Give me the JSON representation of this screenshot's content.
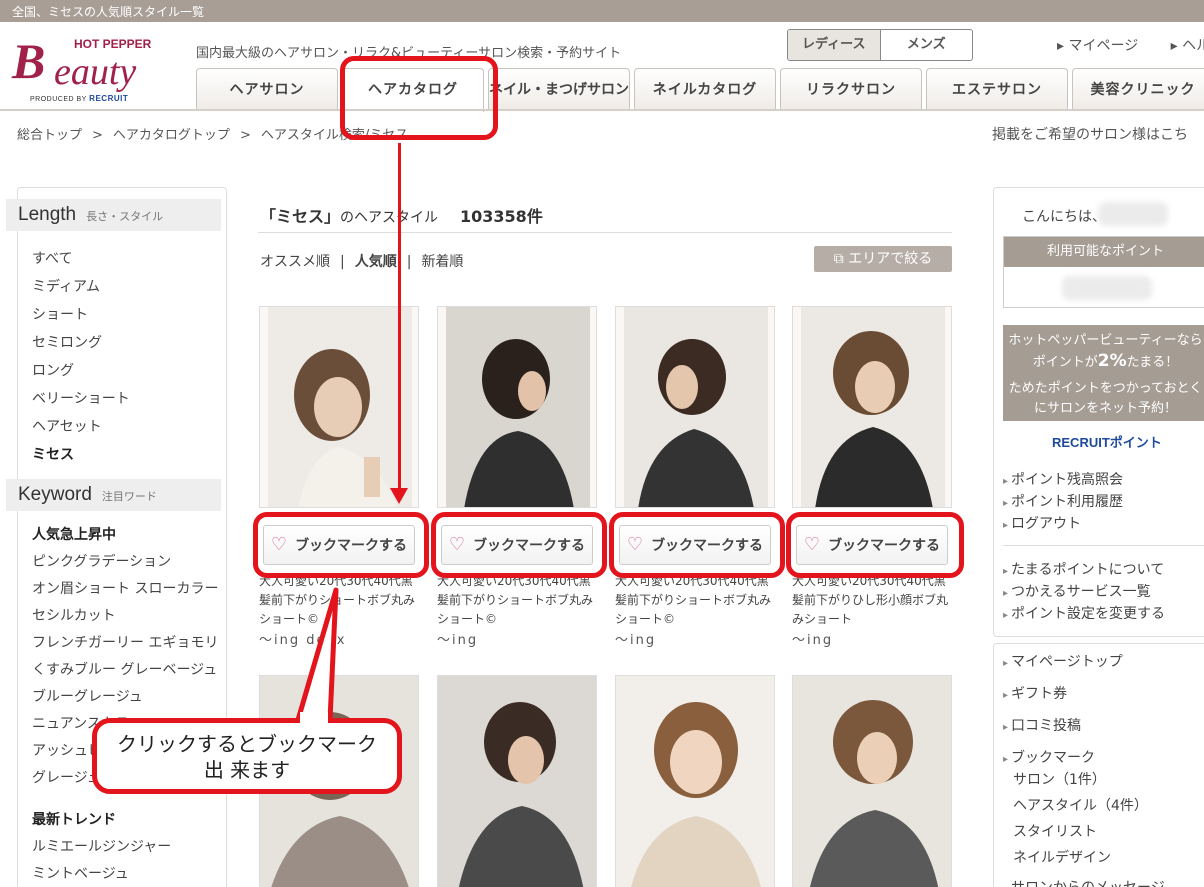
{
  "topbar": {
    "text": "全国、ミセスの人気順スタイル一覧"
  },
  "logo": {
    "brand_small": "HOT PEPPER",
    "brand_b": "B",
    "brand_rest": "eauty",
    "produced": "PRODUCED BY",
    "recruit": "RECRUIT"
  },
  "header": {
    "tagline": "国内最大級のヘアサロン・リラク&ビューティーサロン検索・予約サイト",
    "gender": {
      "ladies": "レディース",
      "mens": "メンズ"
    },
    "links": [
      "マイページ",
      "ヘル"
    ]
  },
  "nav": {
    "tabs": [
      "ヘアサロン",
      "ヘアカタログ",
      "ネイル・まつげサロン",
      "ネイルカタログ",
      "リラクサロン",
      "エステサロン",
      "美容クリニック"
    ]
  },
  "breadcrumb": {
    "items": [
      "総合トップ",
      "ヘアカタログトップ",
      "ヘアスタイル検索/ミセス"
    ],
    "sep": ">"
  },
  "advert_link": "掲載をご希望のサロン様はこち",
  "sidebar": {
    "length_heading": "Length",
    "length_sub": "長さ・スタイル",
    "length_items": [
      "すべて",
      "ミディアム",
      "ショート",
      "セミロング",
      "ロング",
      "ベリーショート",
      "ヘアセット",
      "ミセス"
    ],
    "keyword_heading": "Keyword",
    "keyword_sub": "注目ワード",
    "rising_heading": "人気急上昇中",
    "rising_items": [
      "ピンクグラデーション",
      "オン眉ショート スローカラー",
      "セシルカット",
      "フレンチガーリー エギョモリ",
      "くすみブルー グレーベージュ",
      "ブルーグレージュ",
      "ニュアンスカラ",
      "アッシュピ",
      "グレージュ"
    ],
    "trend_heading": "最新トレンド",
    "trend_items": [
      "ルミエールジンジャー",
      "ミントベージュ"
    ]
  },
  "main": {
    "title_quote": "「ミセス」",
    "title_rest": "のヘアスタイル",
    "count": "103358件",
    "sort": {
      "recommended": "オススメ順",
      "popular": "人気順",
      "newest": "新着順",
      "sep": "|"
    },
    "area_button": "エリアで絞る",
    "bookmark_label": "ブックマークする",
    "cards": [
      {
        "desc": "大人可愛い20代30代40代黒髪前下がりショートボブ丸みショート©",
        "salon": "～ing deux"
      },
      {
        "desc": "大人可愛い20代30代40代黒髪前下がりショートボブ丸みショート©",
        "salon": "～ing"
      },
      {
        "desc": "大人可愛い20代30代40代黒髪前下がりショートボブ丸みショート©",
        "salon": "～ing"
      },
      {
        "desc": "大人可愛い20代30代40代黒髪前下がりひし形小顔ボブ丸みショート",
        "salon": "～ing"
      }
    ]
  },
  "right": {
    "greeting": "こんにちは、",
    "points_available": "利用可能なポイント",
    "promo_line1": "ホットペッパービューティーなら",
    "promo_line2a": "ポイントが",
    "promo_pct": "2%",
    "promo_line2b": "たまる！",
    "promo_line3": "ためたポイントをつかっておとく",
    "promo_line4": "にサロンをネット予約！",
    "recruit_point": "RECRUITポイント",
    "links1": [
      "ポイント残高照会",
      "ポイント利用履歴",
      "ログアウト"
    ],
    "links2": [
      "たまるポイントについて",
      "つかえるサービス一覧",
      "ポイント設定を変更する"
    ],
    "links3": [
      "マイページトップ",
      "ギフト券",
      "口コミ投稿",
      "ブックマーク"
    ],
    "bookmark_sub": [
      "サロン（1件）",
      "ヘアスタイル（4件）",
      "スタイリスト",
      "ネイルデザイン"
    ],
    "last_link": "サロンからのメッセージ"
  },
  "annotation": {
    "callout_line1": "クリックするとブックマーク",
    "callout_line2": "出 来ます"
  },
  "colors": {
    "accent_red": "#e3141c",
    "brand": "#a0214a",
    "topbar": "#a89e95"
  }
}
